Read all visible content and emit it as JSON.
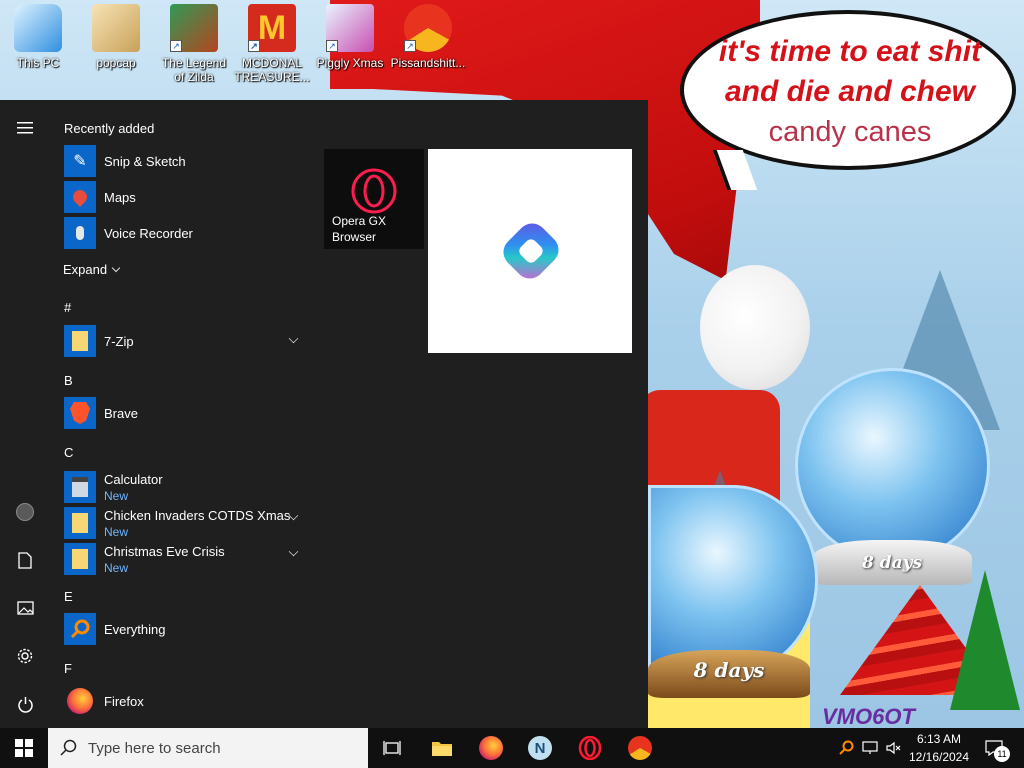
{
  "desktop": {
    "icons": [
      {
        "label": "This PC",
        "icon": "computer-icon"
      },
      {
        "label": "popcap",
        "icon": "folder-icon"
      },
      {
        "label": "The Legend of Zilda",
        "icon": "game-icon"
      },
      {
        "label": "MCDONAL TREASURE...",
        "icon": "mcdonalds-icon"
      },
      {
        "label": "Piggly Xmas",
        "icon": "game-icon"
      },
      {
        "label": "Pissandshitt...",
        "icon": "chrome-like-icon"
      }
    ],
    "wallpaper": {
      "speech_line1": "it's time to eat shit",
      "speech_line2": "and die and chew",
      "speech_line3": "candy canes",
      "globe_label_1": "8 days",
      "globe_label_2": "8 days",
      "watermark": "VMO6OT"
    }
  },
  "start_menu": {
    "recently_added_header": "Recently added",
    "recent": [
      {
        "label": "Snip & Sketch"
      },
      {
        "label": "Maps"
      },
      {
        "label": "Voice Recorder"
      }
    ],
    "expand_label": "Expand",
    "sections": [
      {
        "letter": "#",
        "apps": [
          {
            "label": "7-Zip",
            "new": "",
            "expandable": true
          }
        ]
      },
      {
        "letter": "B",
        "apps": [
          {
            "label": "Brave",
            "new": "",
            "expandable": false
          }
        ]
      },
      {
        "letter": "C",
        "apps": [
          {
            "label": "Calculator",
            "new": "New",
            "expandable": false
          },
          {
            "label": "Chicken Invaders COTDS Xmas",
            "new": "New",
            "expandable": true
          },
          {
            "label": "Christmas Eve Crisis",
            "new": "New",
            "expandable": true
          }
        ]
      },
      {
        "letter": "E",
        "apps": [
          {
            "label": "Everything",
            "new": "",
            "expandable": false
          }
        ]
      },
      {
        "letter": "F",
        "apps": [
          {
            "label": "Firefox",
            "new": "",
            "expandable": false
          }
        ]
      }
    ],
    "tiles": [
      {
        "label": "Opera GX Browser"
      },
      {
        "label": ""
      }
    ]
  },
  "taskbar": {
    "search_placeholder": "Type here to search",
    "clock_time": "6:13 AM",
    "clock_date": "12/16/2024",
    "notification_count": "11"
  },
  "colors": {
    "start_bg": "#1f1f1f",
    "taskbar_bg": "#101010",
    "accent_blue": "#0a66c8",
    "new_badge": "#6fb6ff"
  }
}
